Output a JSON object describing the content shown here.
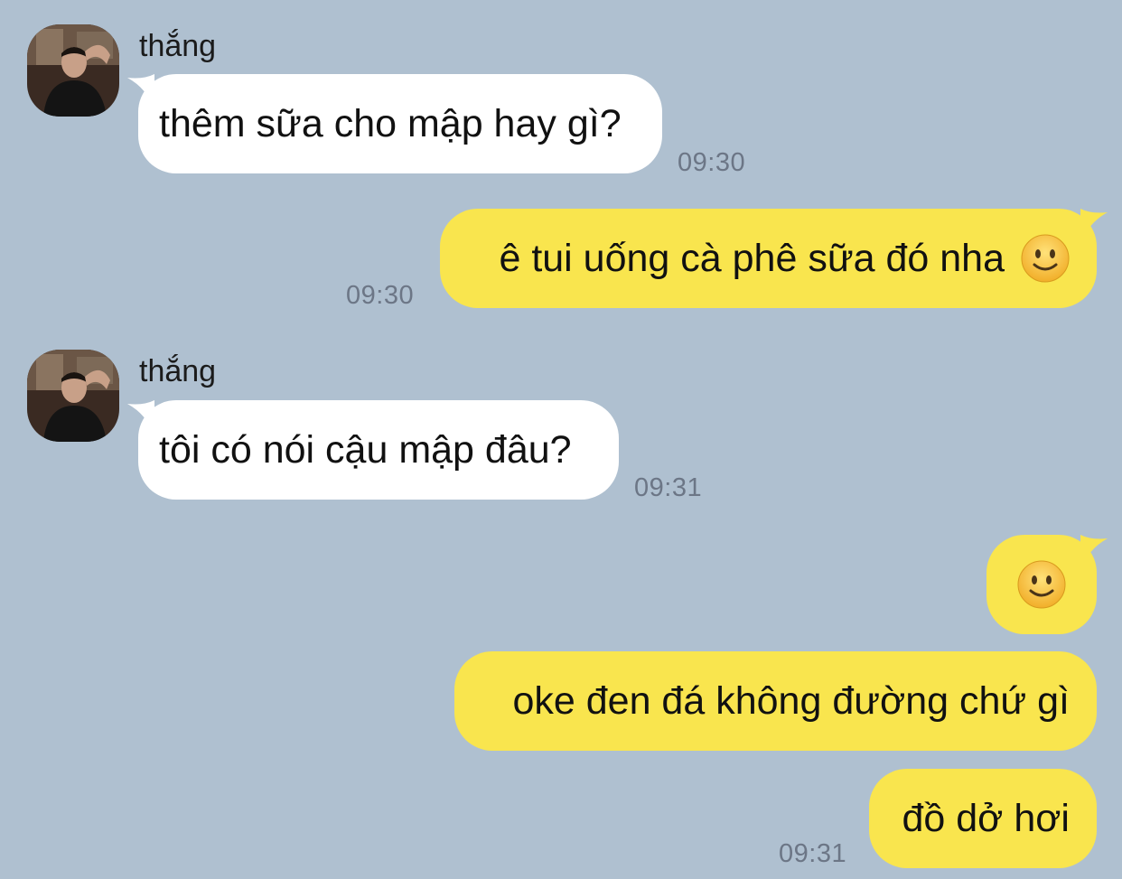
{
  "colors": {
    "background": "#afc0d0",
    "incoming_bubble": "#ffffff",
    "outgoing_bubble": "#f9e54e",
    "timestamp": "#6c7686"
  },
  "messages": [
    {
      "direction": "incoming",
      "sender": "thắng",
      "avatar_icon": "user-avatar-icon",
      "text": "thêm sữa cho mập hay gì?",
      "time": "09:30"
    },
    {
      "direction": "outgoing",
      "text": "ê tui uống cà phê sữa đó nha",
      "emoji": "slightly-smiling-face-icon",
      "time": "09:30"
    },
    {
      "direction": "incoming",
      "sender": "thắng",
      "avatar_icon": "user-avatar-icon",
      "text": "tôi có nói cậu mập đâu?",
      "time": "09:31"
    },
    {
      "direction": "outgoing",
      "text": "",
      "emoji": "slightly-smiling-face-icon"
    },
    {
      "direction": "outgoing",
      "text": "oke đen đá không đường chứ gì"
    },
    {
      "direction": "outgoing",
      "text": "đồ dở hơi",
      "time": "09:31"
    }
  ]
}
